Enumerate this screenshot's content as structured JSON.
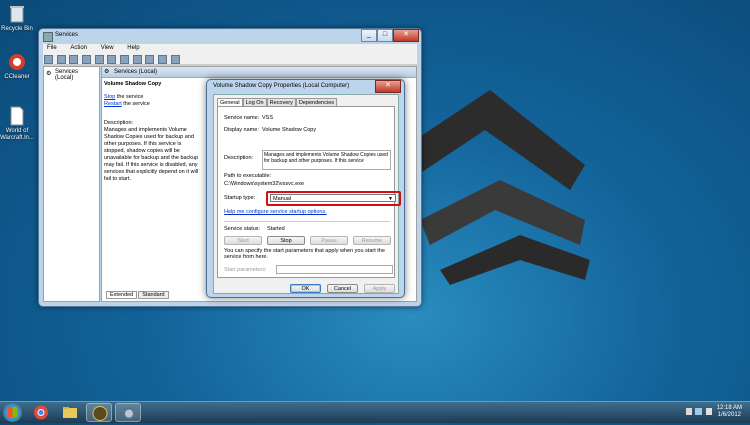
{
  "desktop": {
    "icons": [
      {
        "label": "Recycle Bin",
        "icon": "recycle-bin-icon"
      },
      {
        "label": "CCleaner",
        "icon": "ccleaner-icon"
      },
      {
        "label": "World of Warcraft.ln...",
        "icon": "document-icon"
      }
    ]
  },
  "services_window": {
    "title": "Services",
    "menu": [
      "File",
      "Action",
      "View",
      "Help"
    ],
    "tree_item": "Services (Local)",
    "pane_header": "Services (Local)",
    "service_name": "Volume Shadow Copy",
    "stop_link": "Stop",
    "stop_rest": " the service",
    "restart_link": "Restart",
    "restart_rest": " the service",
    "description_label": "Description:",
    "description": "Manages and implements Volume Shadow Copies used for backup and other purposes. If this service is stopped, shadow copies will be unavailable for backup and the backup may fail. If this service is disabled, any services that explicitly depend on it will fail to start.",
    "tabs": [
      "Extended",
      "Standard"
    ]
  },
  "dialog": {
    "title": "Volume Shadow Copy Properties (Local Computer)",
    "tabs": [
      "General",
      "Log On",
      "Recovery",
      "Dependencies"
    ],
    "service_name_label": "Service name:",
    "service_name_value": "VSS",
    "display_name_label": "Display name:",
    "display_name_value": "Volume Shadow Copy",
    "description_label": "Description:",
    "description_value": "Manages and implements Volume Shadow Copies used for backup and other purposes. If this service",
    "path_label": "Path to executable:",
    "path_value": "C:\\Windows\\system32\\vssvc.exe",
    "startup_type_label": "Startup type:",
    "startup_type_value": "Manual",
    "help_link": "Help me configure service startup options.",
    "service_status_label": "Service status:",
    "service_status_value": "Started",
    "buttons": {
      "start": "Start",
      "stop": "Stop",
      "pause": "Pause",
      "resume": "Resume"
    },
    "params_text": "You can specify the start parameters that apply when you start the service from here.",
    "start_params_label": "Start parameters:",
    "ok": "OK",
    "cancel": "Cancel",
    "apply": "Apply"
  },
  "taskbar": {
    "time": "12:18 AM",
    "date": "1/6/2012"
  },
  "colors": {
    "highlight": "#d20e17",
    "link": "#0033cc"
  }
}
